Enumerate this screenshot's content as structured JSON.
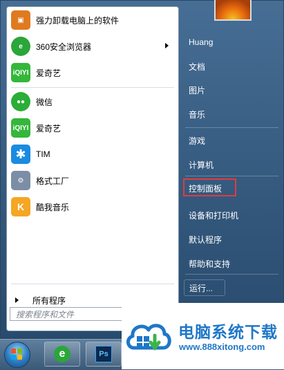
{
  "pinned_programs": [
    {
      "label": "强力卸载电脑上的软件",
      "icon": "uninstall-box-icon",
      "color": "#e07a1f"
    },
    {
      "label": "360安全浏览器",
      "icon": "browser-360-icon",
      "color": "#2aa63a",
      "has_submenu": true
    },
    {
      "label": "爱奇艺",
      "icon": "iqiyi-icon",
      "color": "#34b73a",
      "icon_text": "iQIYI"
    }
  ],
  "recent_programs": [
    {
      "label": "微信",
      "icon": "wechat-icon",
      "color": "#2aae37"
    },
    {
      "label": "爱奇艺",
      "icon": "iqiyi-icon",
      "color": "#34b73a",
      "icon_text": "iQIYI"
    },
    {
      "label": "TIM",
      "icon": "tim-icon",
      "color": "#1a8be0",
      "icon_text": "✱"
    },
    {
      "label": "格式工厂",
      "icon": "format-factory-icon",
      "color": "#7b8ea6"
    },
    {
      "label": "酷我音乐",
      "icon": "kuwo-music-icon",
      "color": "#f5a623",
      "icon_text": "K"
    }
  ],
  "all_programs_label": "所有程序",
  "search_placeholder": "搜索程序和文件",
  "right_items": [
    "Huang",
    "文档",
    "图片",
    "音乐",
    "游戏",
    "计算机",
    "控制面板",
    "设备和打印机",
    "默认程序",
    "帮助和支持"
  ],
  "highlighted_item": "控制面板",
  "shutdown_label": "运行...",
  "taskbar": {
    "ps_label": "Ps",
    "browser_glyph": "e"
  },
  "watermark": {
    "title": "电脑系统下载",
    "url": "www.888xitong.com"
  }
}
